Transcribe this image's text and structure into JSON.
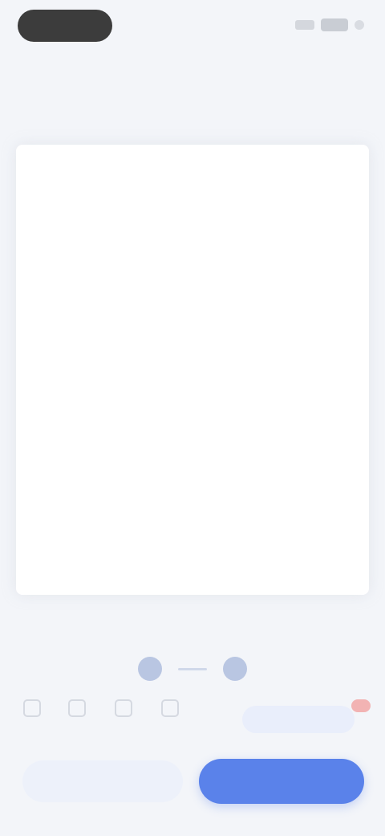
{
  "header": {
    "back_label": "",
    "back_caption": "",
    "right_caption": ""
  },
  "document": {
    "lines": [
      "",
      "",
      "",
      "",
      "",
      "",
      "",
      "",
      "",
      "",
      "",
      "",
      "",
      "",
      "",
      "",
      "",
      "",
      "",
      ""
    ]
  },
  "pager": {
    "current": 1,
    "total": 2
  },
  "toolbar": {
    "tools": [
      "",
      "",
      "",
      ""
    ],
    "summary_label": "",
    "badge": ""
  },
  "actions": {
    "secondary_label": "",
    "primary_label": ""
  },
  "colors": {
    "accent": "#5a82ea",
    "background": "#f3f5f9",
    "card": "#ffffff"
  },
  "icons": {
    "status": [
      "signal-icon",
      "battery-icon",
      "menu-dot-icon"
    ],
    "tools": [
      "tool-icon-1",
      "tool-icon-2",
      "tool-icon-3",
      "tool-icon-4"
    ]
  }
}
